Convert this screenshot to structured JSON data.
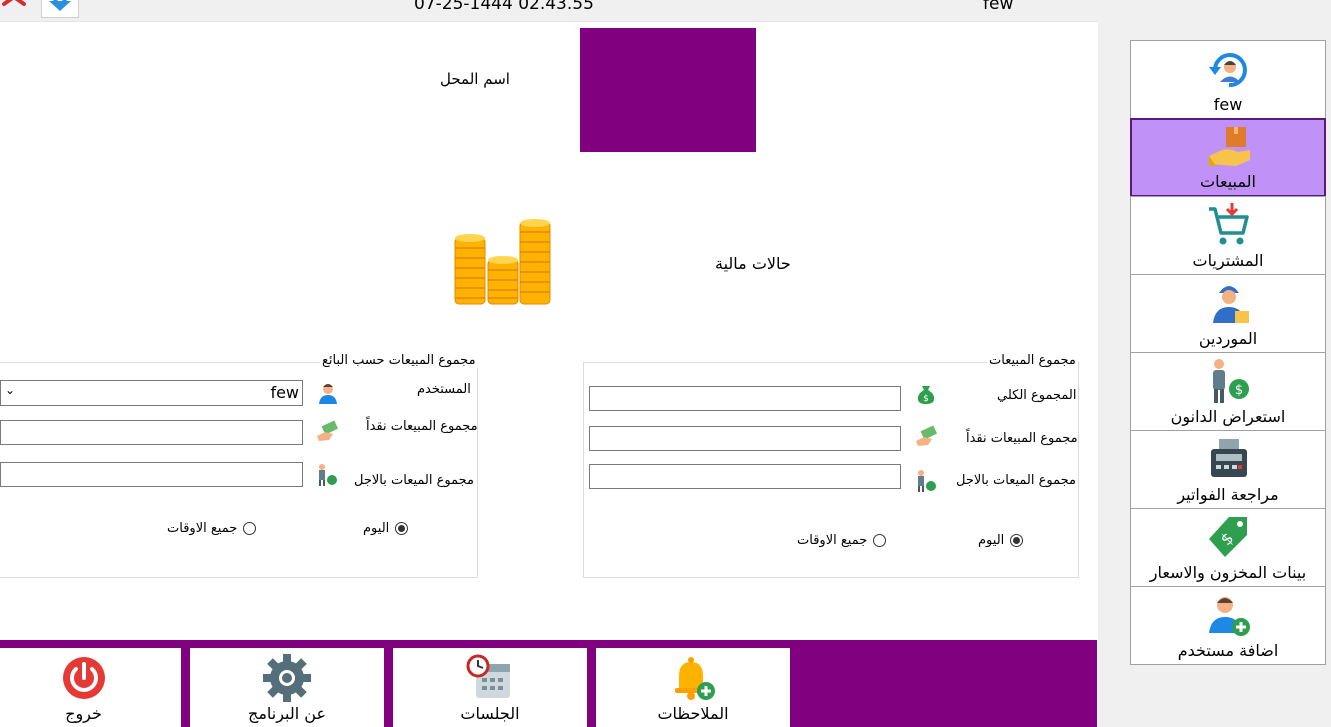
{
  "topbar": {
    "datetime": "07-25-1444 02.43.55",
    "user": "few"
  },
  "sidebar": {
    "items": [
      {
        "label": "few"
      },
      {
        "label": "المبيعات"
      },
      {
        "label": "المشتريات"
      },
      {
        "label": "الموردين"
      },
      {
        "label": "استعراض الدانون"
      },
      {
        "label": "مراجعة الفواتير"
      },
      {
        "label": "بينات المخزون والاسعار"
      },
      {
        "label": "اضافة مستخدم"
      }
    ]
  },
  "main": {
    "shop_name_label": "اسم المحل",
    "financial_label": "حالات مالية"
  },
  "sales_totals": {
    "title": "مجموع المبيعات",
    "total_label": "المجموع الكلي",
    "cash_label": "مجموع المبيعات نقداً",
    "credit_label": "مجموع الميعات بالاجل",
    "total_value": "",
    "cash_value": "",
    "credit_value": "",
    "radio_today": "اليوم",
    "radio_all": "جميع الاوقات"
  },
  "sales_by_seller": {
    "title": "مجموع المبيعات حسب البائع",
    "user_label": "المستخدم",
    "user_value": "few",
    "cash_label": "مجموع المبيعات نقداً",
    "credit_label": "مجموع الميعات بالاجل",
    "cash_value": "",
    "credit_value": "",
    "radio_today": "اليوم",
    "radio_all": "جميع الاوقات"
  },
  "bottombar": {
    "exit_label": "خروج",
    "about_label": "عن البرنامج",
    "sessions_label": "الجلسات",
    "notes_label": "الملاحظات"
  },
  "colors": {
    "brand": "#800080",
    "active_item": "#c091f7"
  }
}
